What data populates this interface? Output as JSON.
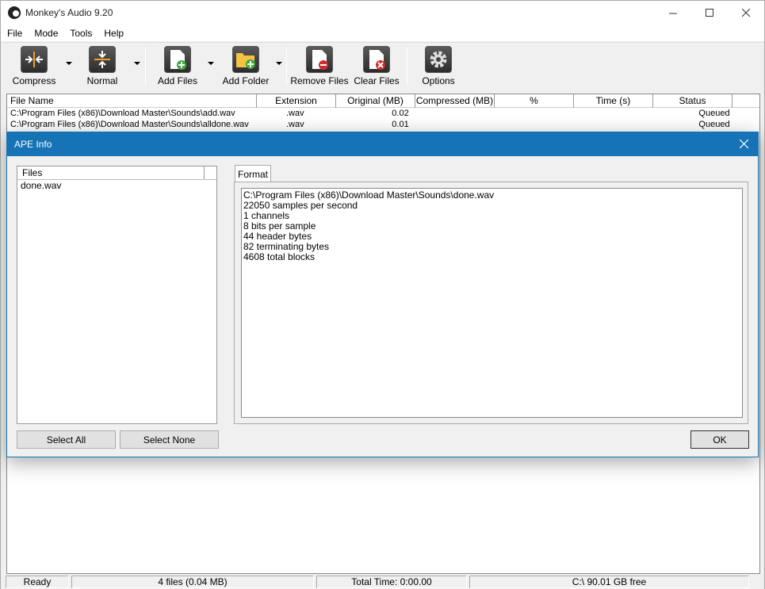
{
  "window": {
    "title": "Monkey's Audio 9.20"
  },
  "menu": [
    "File",
    "Mode",
    "Tools",
    "Help"
  ],
  "toolbar": {
    "compress": "Compress",
    "normal": "Normal",
    "add_files": "Add Files",
    "add_folder": "Add Folder",
    "remove_files": "Remove Files",
    "clear_files": "Clear Files",
    "options": "Options"
  },
  "list": {
    "columns": [
      "File Name",
      "Extension",
      "Original (MB)",
      "Compressed (MB)",
      "%",
      "Time (s)",
      "Status"
    ],
    "rows": [
      {
        "file": "C:\\Program Files (x86)\\Download Master\\Sounds\\add.wav",
        "ext": ".wav",
        "original": "0.02",
        "compressed": "",
        "pct": "",
        "time": "",
        "status": "Queued"
      },
      {
        "file": "C:\\Program Files (x86)\\Download Master\\Sounds\\alldone.wav",
        "ext": ".wav",
        "original": "0.01",
        "compressed": "",
        "pct": "",
        "time": "",
        "status": "Queued"
      }
    ]
  },
  "dialog": {
    "title": "APE Info",
    "files_header": "Files",
    "files": [
      "done.wav"
    ],
    "select_all": "Select All",
    "select_none": "Select None",
    "tab": "Format",
    "info_lines": [
      "C:\\Program Files (x86)\\Download Master\\Sounds\\done.wav",
      "22050 samples per second",
      "1 channels",
      "8 bits per sample",
      "44 header bytes",
      "82 terminating bytes",
      "4608 total blocks"
    ],
    "ok": "OK"
  },
  "status": {
    "state": "Ready",
    "files": "4 files (0.04 MB)",
    "total_time": "Total Time: 0:00.00",
    "disk": "C:\\ 90.01 GB free"
  },
  "colors": {
    "accent": "#1673b5"
  }
}
